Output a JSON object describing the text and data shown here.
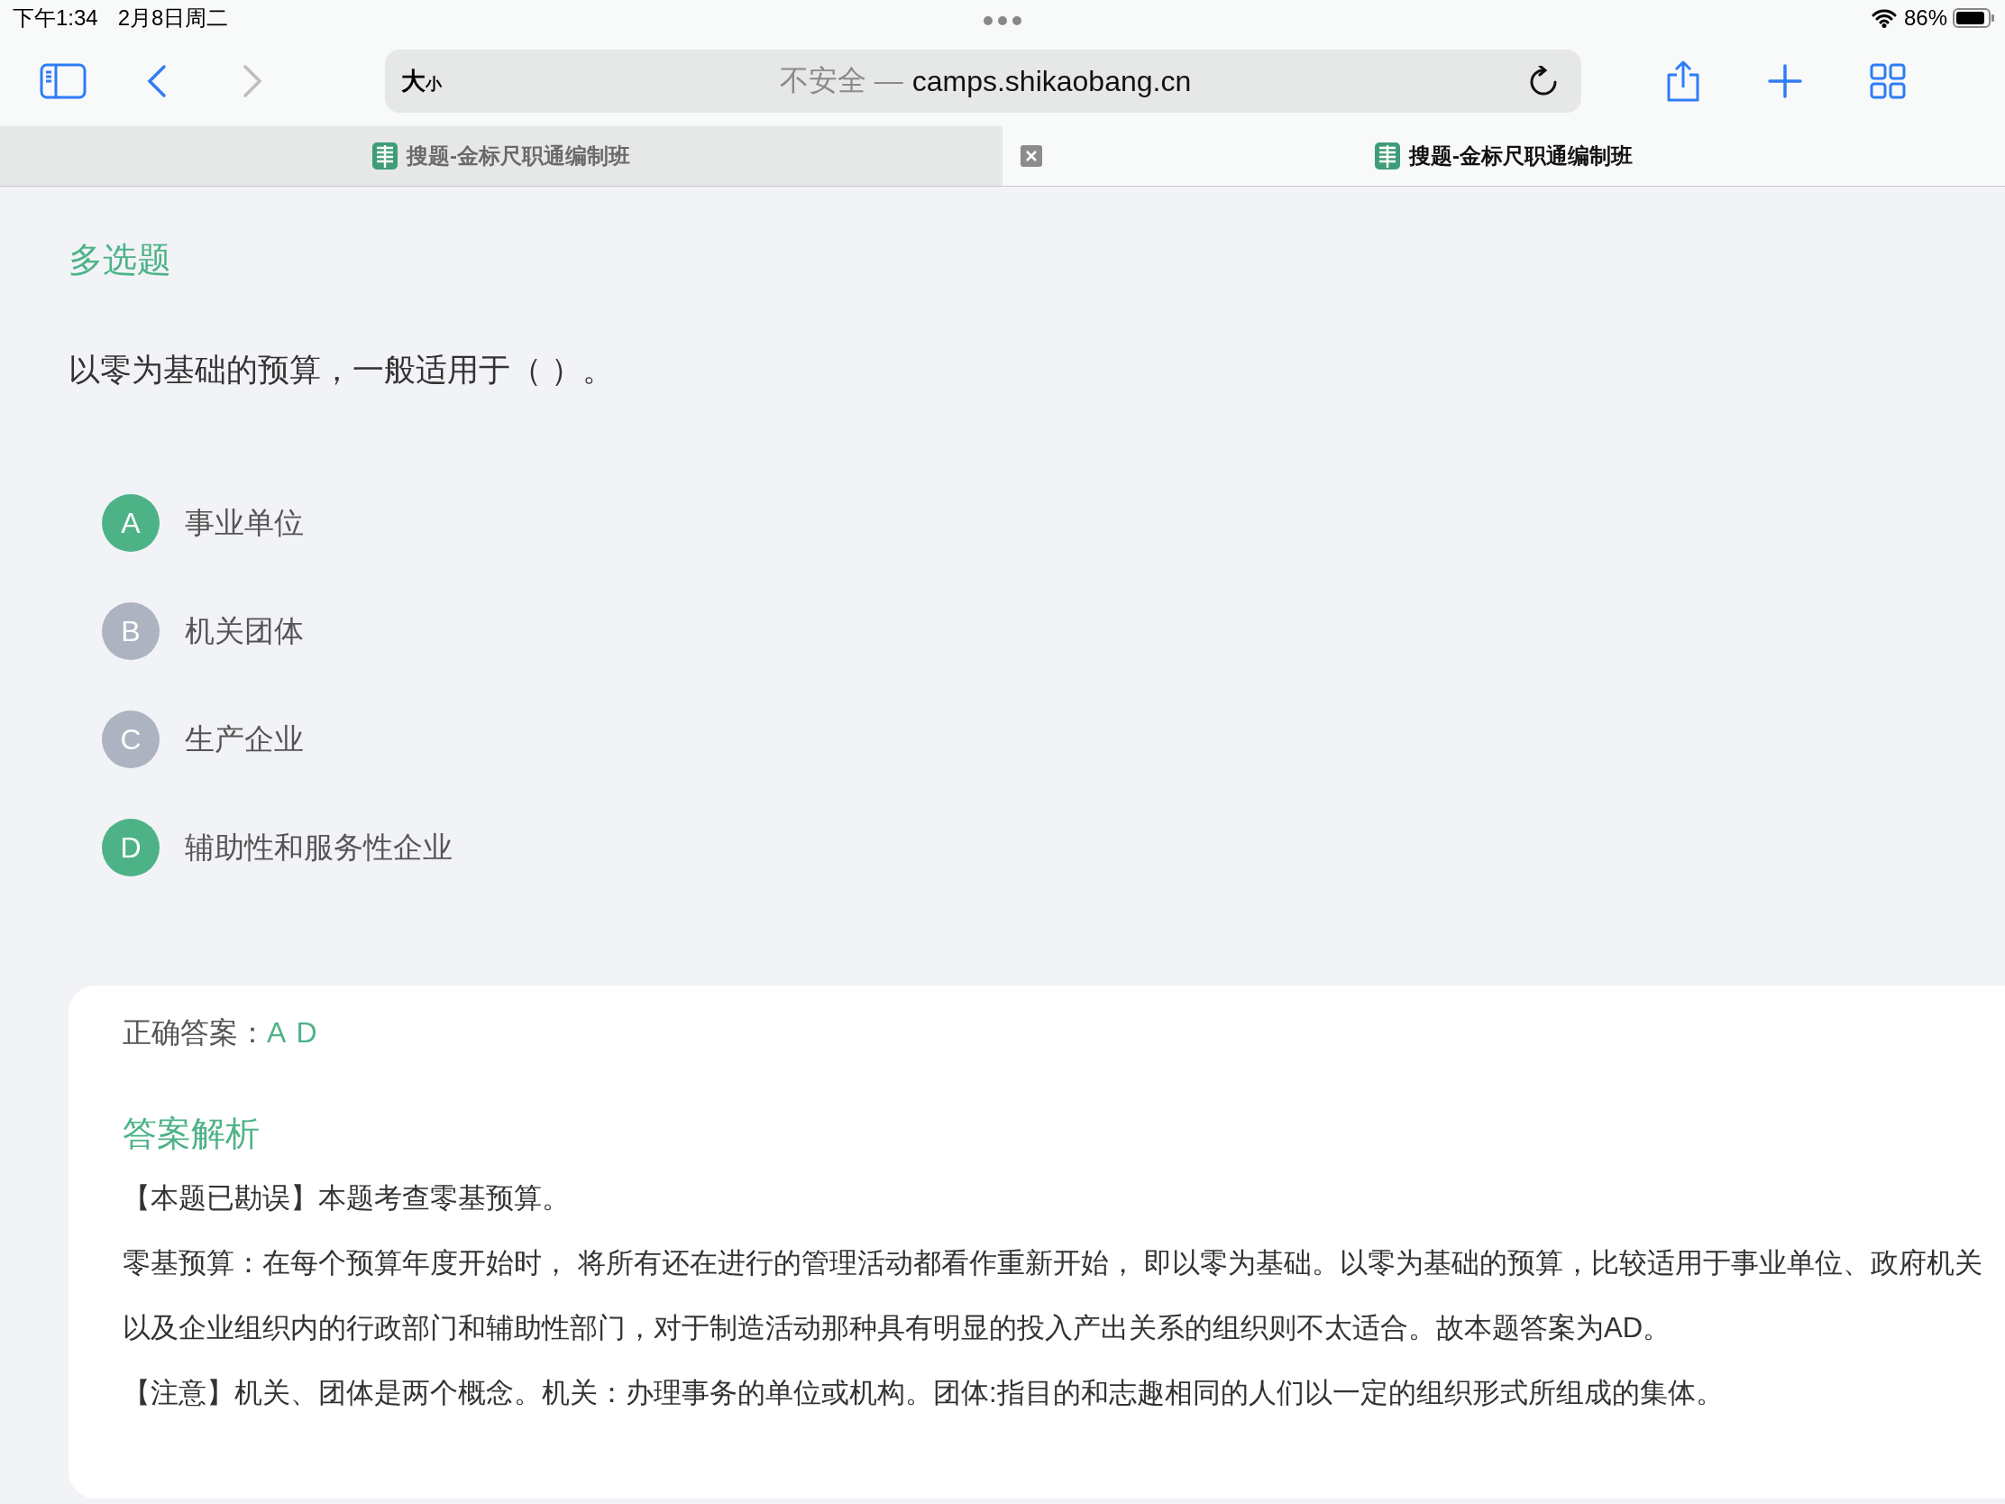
{
  "status_bar": {
    "time": "下午1:34",
    "date": "2月8日周二",
    "battery": "86%"
  },
  "toolbar": {
    "text_size_large": "大",
    "text_size_small": "小",
    "address": {
      "security": "不安全 —",
      "domain": "camps.shikaobang.cn"
    }
  },
  "tabs": [
    {
      "title": "搜题-金标尺职通编制班",
      "selected": false
    },
    {
      "title": "搜题-金标尺职通编制班",
      "selected": true
    }
  ],
  "question": {
    "type_label": "多选题",
    "stem": "以零为基础的预算，一般适用于（ ）。",
    "options": [
      {
        "letter": "A",
        "text": "事业单位",
        "selected": true
      },
      {
        "letter": "B",
        "text": "机关团体",
        "selected": false
      },
      {
        "letter": "C",
        "text": "生产企业",
        "selected": false
      },
      {
        "letter": "D",
        "text": "辅助性和服务性企业",
        "selected": true
      }
    ]
  },
  "answer": {
    "label": "正确答案：",
    "value": "A D",
    "analysis_title": "答案解析",
    "paragraphs": [
      "【本题已勘误】本题考查零基预算。",
      "零基预算：在每个预算年度开始时， 将所有还在进行的管理活动都看作重新开始， 即以零为基础。以零为基础的预算，比较适用于事业单位、政府机关以及企业组织内的行政部门和辅助性部门，对于制造活动那种具有明显的投入产出关系的组织则不太适合。故本题答案为AD。",
      "【注意】机关、团体是两个概念。机关：办理事务的单位或机构。团体:指目的和志趣相同的人们以一定的组织形式所组成的集体。"
    ]
  }
}
